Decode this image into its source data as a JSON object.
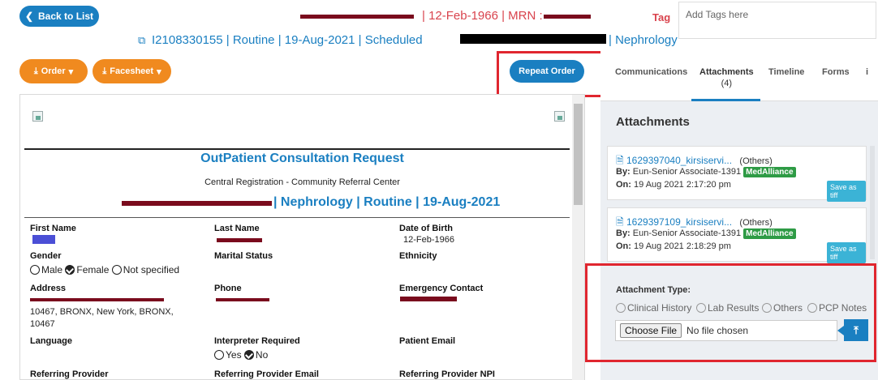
{
  "header": {
    "back_label": "Back to List",
    "dob_mrn": "| 12-Feb-1966 | MRN :",
    "order_line": "I2108330155 | Routine | 19-Aug-2021 | Scheduled",
    "dept": "| Nephrology",
    "tag_label": "Tag",
    "tag_placeholder": "Add Tags here"
  },
  "toolbar": {
    "order_label": "Order",
    "facesheet_label": "Facesheet",
    "repeat_order_label": "Repeat Order"
  },
  "document": {
    "title": "OutPatient Consultation Request",
    "subtitle": "Central Registration - Community Referral Center",
    "service_line": "| Nephrology | Routine | 19-Aug-2021",
    "fields": {
      "first_name_label": "First Name",
      "last_name_label": "Last Name",
      "dob_label": "Date of Birth",
      "dob_value": "12-Feb-1966",
      "gender_label": "Gender",
      "gender_male": "Male",
      "gender_female": "Female",
      "gender_not_specified": "Not specified",
      "marital_label": "Marital Status",
      "ethnicity_label": "Ethnicity",
      "address_label": "Address",
      "address_line2": "10467, BRONX, New York, BRONX,",
      "address_line3": "10467",
      "phone_label": "Phone",
      "emergency_label": "Emergency Contact",
      "language_label": "Language",
      "interpreter_label": "Interpreter Required",
      "interpreter_yes": "Yes",
      "interpreter_no": "No",
      "patient_email_label": "Patient Email",
      "ref_provider_label": "Referring Provider",
      "ref_provider_email_label": "Referring Provider Email",
      "ref_provider_npi_label": "Referring Provider NPI"
    }
  },
  "right_panel": {
    "tabs": [
      {
        "label": "Communications"
      },
      {
        "label": "Attachments",
        "count": "(4)"
      },
      {
        "label": "Timeline"
      },
      {
        "label": "Forms"
      },
      {
        "label": "i"
      }
    ],
    "section_title": "Attachments",
    "attachments": [
      {
        "file": "1629397040_kirsiservi...",
        "category": "(Others)",
        "by_label": "By:",
        "by": "Eun-Senior Associate-1391",
        "org": "MedAlliance",
        "on_label": "On:",
        "on": "19 Aug 2021 2:17:20 pm",
        "save_label": "Save as tiff"
      },
      {
        "file": "1629397109_kirsiservi...",
        "category": "(Others)",
        "by_label": "By:",
        "by": "Eun-Senior Associate-1391",
        "org": "MedAlliance",
        "on_label": "On:",
        "on": "19 Aug 2021 2:18:29 pm",
        "save_label": "Save as tiff"
      }
    ],
    "upload": {
      "type_label": "Attachment Type:",
      "options": [
        "Clinical History",
        "Lab Results",
        "Others",
        "PCP Notes"
      ],
      "choose_label": "Choose File",
      "no_file": "No file chosen"
    }
  },
  "colors": {
    "primary": "#1a7fc1",
    "orange": "#f08a1f",
    "danger": "#e0262f",
    "header_red": "#d9434d",
    "green_badge": "#2e9b45"
  }
}
